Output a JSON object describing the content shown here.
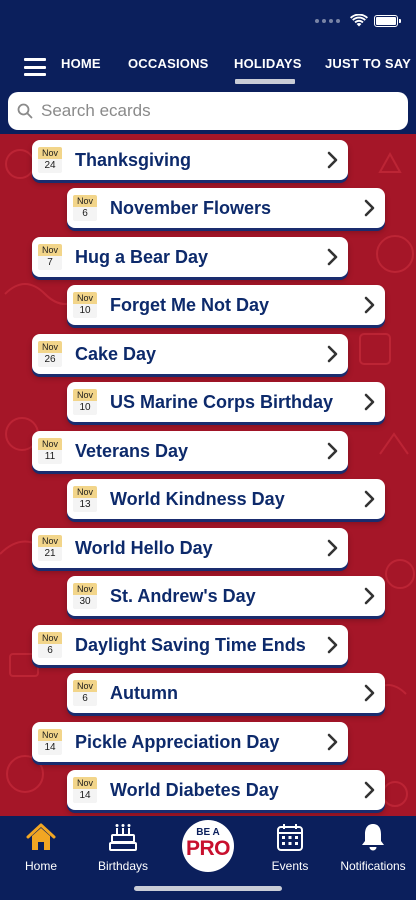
{
  "nav": {
    "tabs": [
      {
        "label": "HOME"
      },
      {
        "label": "OCCASIONS"
      },
      {
        "label": "HOLIDAYS",
        "active": true
      },
      {
        "label": "JUST TO SAY"
      }
    ]
  },
  "search": {
    "placeholder": "Search ecards"
  },
  "list": {
    "items": [
      {
        "month": "Nov",
        "day": "24",
        "title": "Thanksgiving"
      },
      {
        "month": "Nov",
        "day": "6",
        "title": "November Flowers"
      },
      {
        "month": "Nov",
        "day": "7",
        "title": "Hug a Bear Day"
      },
      {
        "month": "Nov",
        "day": "10",
        "title": "Forget Me Not Day"
      },
      {
        "month": "Nov",
        "day": "26",
        "title": "Cake Day"
      },
      {
        "month": "Nov",
        "day": "10",
        "title": "US Marine Corps Birthday"
      },
      {
        "month": "Nov",
        "day": "11",
        "title": "Veterans Day"
      },
      {
        "month": "Nov",
        "day": "13",
        "title": "World Kindness Day"
      },
      {
        "month": "Nov",
        "day": "21",
        "title": "World Hello Day"
      },
      {
        "month": "Nov",
        "day": "30",
        "title": "St. Andrew's Day"
      },
      {
        "month": "Nov",
        "day": "6",
        "title": "Daylight Saving Time Ends"
      },
      {
        "month": "Nov",
        "day": "6",
        "title": "Autumn"
      },
      {
        "month": "Nov",
        "day": "14",
        "title": "Pickle Appreciation Day"
      },
      {
        "month": "Nov",
        "day": "14",
        "title": "World Diabetes Day"
      }
    ]
  },
  "bottom_nav": {
    "home": "Home",
    "birthdays": "Birthdays",
    "pro_top": "BE A",
    "pro_bottom": "PRO",
    "events": "Events",
    "notifications": "Notifications"
  },
  "colors": {
    "navy": "#0b1f5c",
    "background_red": "#a51628",
    "title_text": "#0d2a6b",
    "date_header": "#f2d58a"
  }
}
